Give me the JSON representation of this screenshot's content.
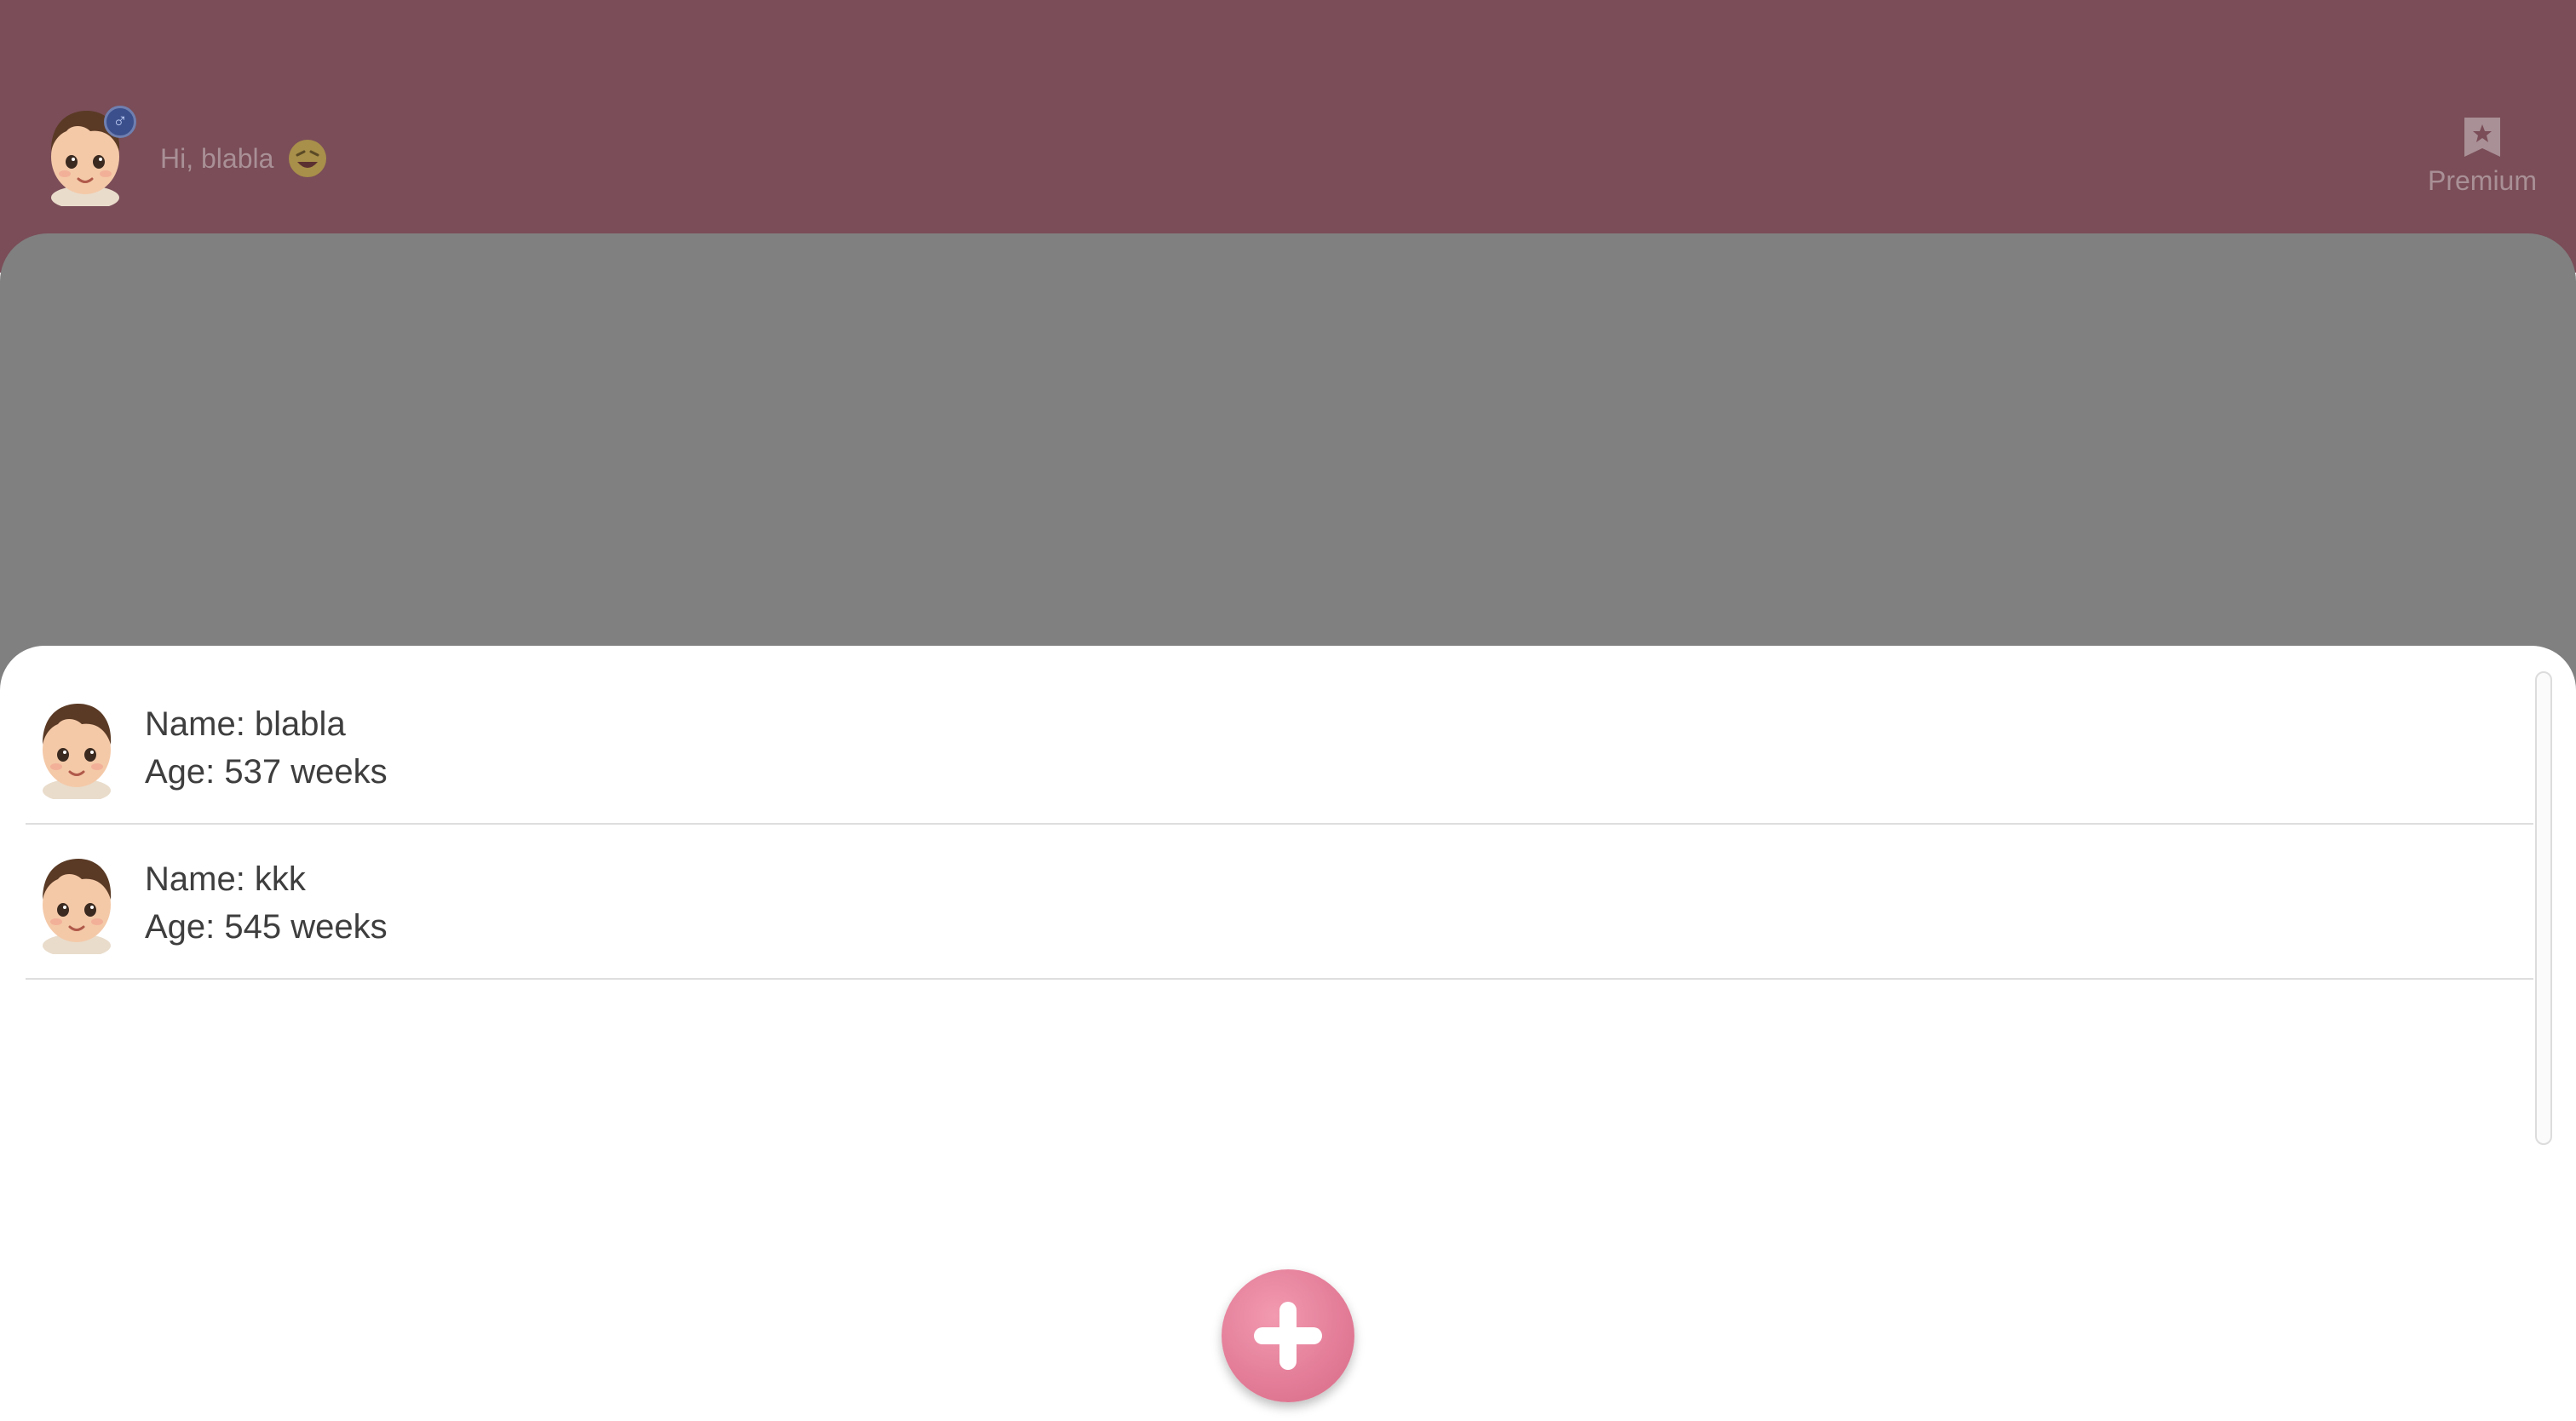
{
  "header": {
    "greeting": "Hi, blabla",
    "gender_symbol": "♂",
    "premium_label": "Premium",
    "avatar_icon": "baby-avatar-icon",
    "emoji_icon": "laughing-emoji-icon",
    "premium_icon": "bookmark-star-icon"
  },
  "main": {
    "mic_icon": "microphone-icon"
  },
  "children_list": {
    "items": [
      {
        "name_line": "Name: blabla",
        "age_line": "Age: 537 weeks"
      },
      {
        "name_line": "Name: kkk",
        "age_line": "Age: 545 weeks"
      }
    ]
  },
  "add_button": {
    "icon": "plus-icon"
  },
  "colors": {
    "header_bg": "#7a4d58",
    "dim_overlay": "#808080",
    "accent_pink": "#e47e99",
    "badge_blue": "#3a4f8c"
  }
}
